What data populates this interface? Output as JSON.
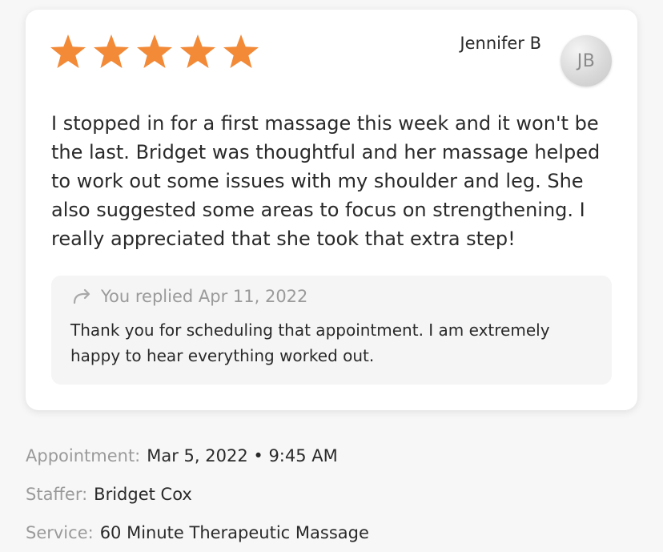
{
  "review": {
    "rating": 5,
    "rating_max": 5,
    "star_color": "#f28a38",
    "reviewer_name": "Jennifer B",
    "reviewer_initials": "JB",
    "text": "I stopped in for a first massage this week and it won't be the last. Bridget was thoughtful and her massage helped to work out some issues with my shoulder and leg. She also suggested some areas to focus on strengthening. I really appreciated that she took that extra step!"
  },
  "reply": {
    "icon": "reply-arrow-icon",
    "meta": "You replied Apr 11, 2022",
    "text": "Thank you for scheduling that appointment. I am extremely happy to hear everything worked out."
  },
  "details": {
    "appointment_label": "Appointment:",
    "appointment_value": "Mar 5, 2022 • 9:45 AM",
    "staffer_label": "Staffer:",
    "staffer_value": "Bridget Cox",
    "service_label": "Service:",
    "service_value": "60 Minute Therapeutic Massage"
  }
}
